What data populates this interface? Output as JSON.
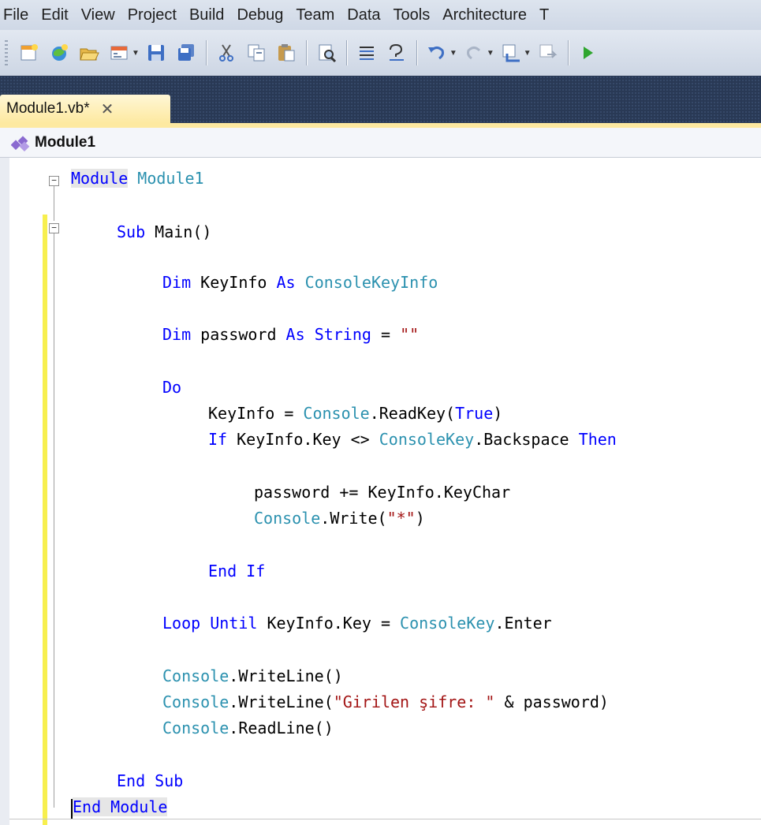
{
  "menu": [
    "File",
    "Edit",
    "View",
    "Project",
    "Build",
    "Debug",
    "Team",
    "Data",
    "Tools",
    "Architecture",
    "T"
  ],
  "toolbar_icons": [
    "new-project-icon",
    "add-item-icon",
    "open-file-icon",
    "add-new-item-icon",
    "save-icon",
    "save-all-icon",
    "cut-icon",
    "copy-icon",
    "paste-icon",
    "find-icon",
    "comment-icon",
    "uncomment-icon",
    "undo-icon",
    "redo-icon",
    "navigate-backward-icon",
    "navigate-forward-icon",
    "start-debugging-icon"
  ],
  "tab": {
    "title": "Module1.vb*",
    "close": "✕"
  },
  "navbar": {
    "module": "Module1"
  },
  "code": {
    "l1": {
      "kw": "Module",
      "name": "Module1"
    },
    "l2": {
      "kw": "Sub",
      "rest": "Main()"
    },
    "l3": {
      "kw1": "Dim",
      "var": "KeyInfo",
      "kw2": "As",
      "type": "ConsoleKeyInfo"
    },
    "l4": {
      "kw1": "Dim",
      "var": "password",
      "kw2": "As",
      "kw3": "String",
      "eq": "=",
      "str": "\"\""
    },
    "l5": {
      "kw": "Do"
    },
    "l6": {
      "pre": "KeyInfo = ",
      "type": "Console",
      "mid": ".ReadKey(",
      "kw": "True",
      "post": ")"
    },
    "l7": {
      "kw1": "If",
      "mid": "KeyInfo.Key <> ",
      "type": "ConsoleKey",
      "post": ".Backspace",
      "kw2": "Then"
    },
    "l8": {
      "text": "password += KeyInfo.KeyChar"
    },
    "l9": {
      "type": "Console",
      "mid": ".Write(",
      "str": "\"*\"",
      "post": ")"
    },
    "l10": {
      "kw": "End If"
    },
    "l11": {
      "kw": "Loop Until",
      "mid": "KeyInfo.Key = ",
      "type": "ConsoleKey",
      "post": ".Enter"
    },
    "l12": {
      "type": "Console",
      "post": ".WriteLine()"
    },
    "l13": {
      "type": "Console",
      "mid": ".WriteLine(",
      "str": "\"Girilen şifre: \"",
      "post": " & password)"
    },
    "l14": {
      "type": "Console",
      "post": ".ReadLine()"
    },
    "l15": {
      "kw": "End Sub"
    },
    "l16": {
      "kw": "End Module"
    }
  }
}
